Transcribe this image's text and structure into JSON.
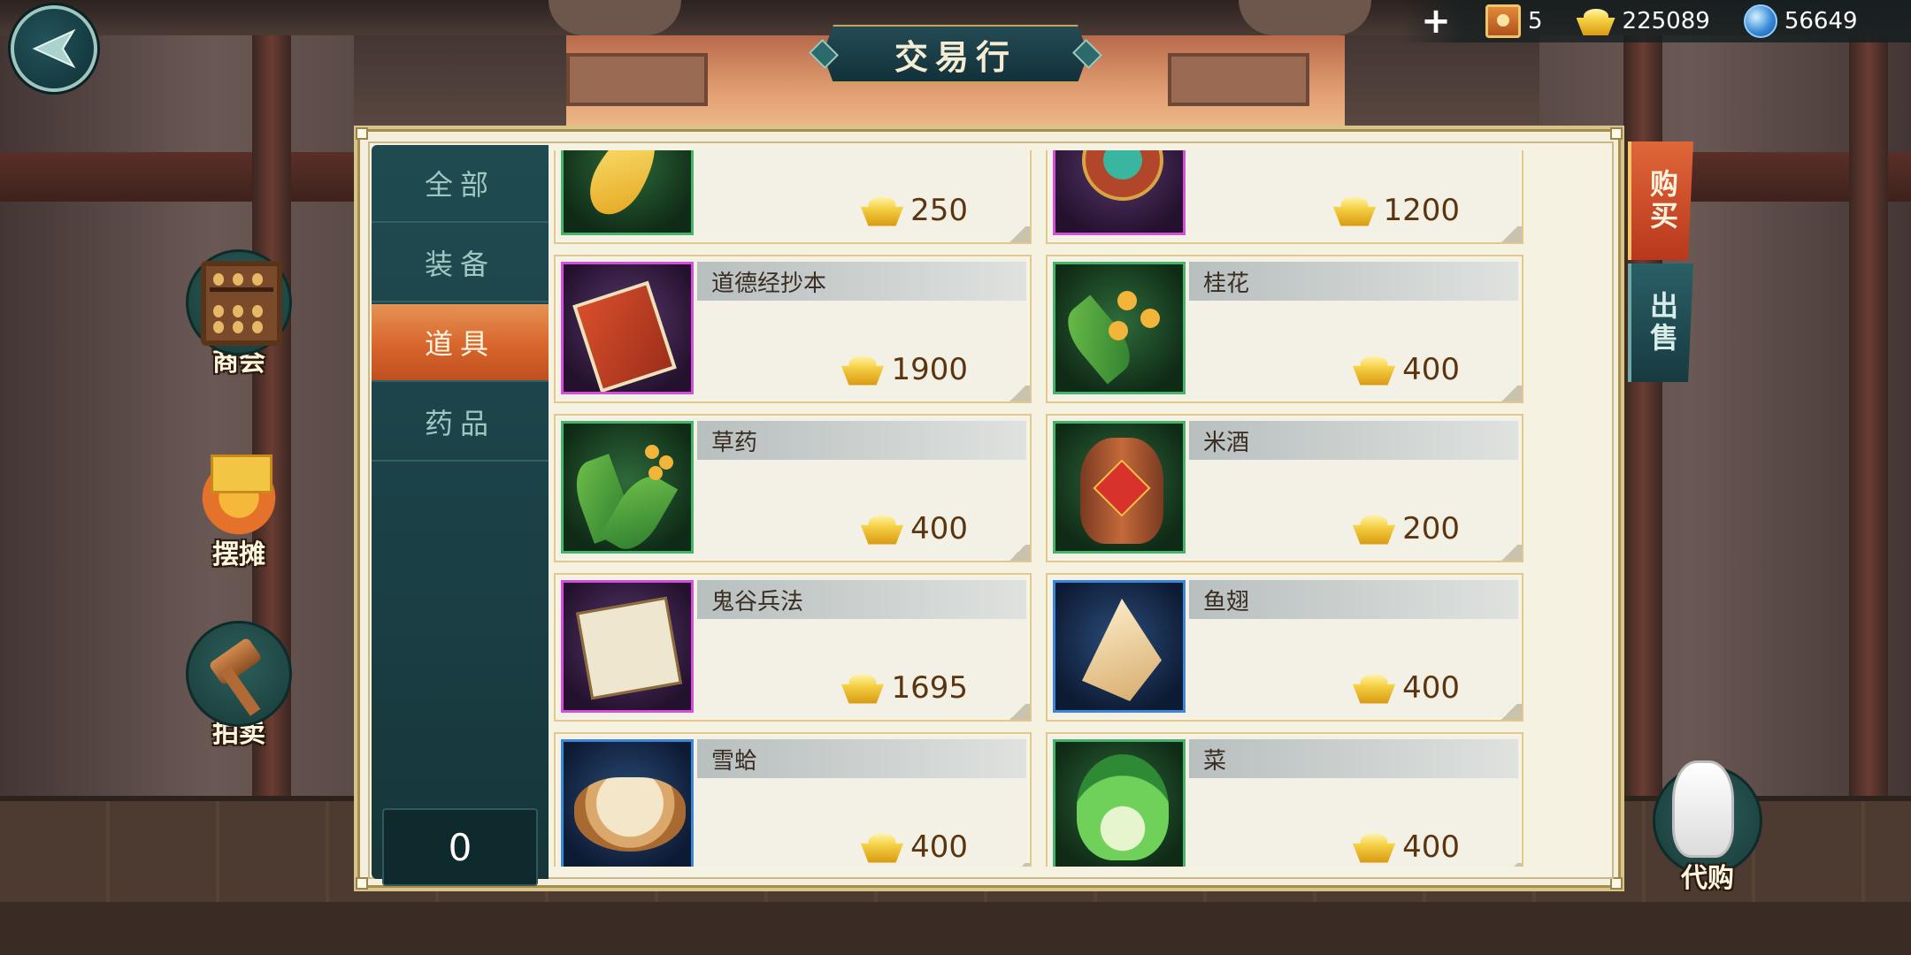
{
  "title": "交易行",
  "currencies": [
    {
      "icon": "ticket-icon",
      "value": "5"
    },
    {
      "icon": "gold-ingot-icon",
      "value": "225089"
    },
    {
      "icon": "blue-pearl-icon",
      "value": "56649"
    }
  ],
  "side_menu": [
    {
      "label": "商会",
      "icon": "abacus-icon"
    },
    {
      "label": "摆摊",
      "icon": "stall-icon"
    },
    {
      "label": "拍卖",
      "icon": "gavel-icon"
    }
  ],
  "categories": [
    "全部",
    "装备",
    "道具",
    "药品"
  ],
  "active_category": "道具",
  "counter": "0",
  "items": [
    {
      "name": "",
      "price": "250",
      "icon": "golden-feather-icon",
      "quality": "green"
    },
    {
      "name": "",
      "price": "1200",
      "icon": "embroidered-ball-icon",
      "quality": "purple"
    },
    {
      "name": "道德经抄本",
      "price": "1900",
      "icon": "book-icon",
      "quality": "purple"
    },
    {
      "name": "桂花",
      "price": "400",
      "icon": "osmanthus-icon",
      "quality": "green"
    },
    {
      "name": "草药",
      "price": "400",
      "icon": "herb-icon",
      "quality": "green"
    },
    {
      "name": "米酒",
      "price": "200",
      "icon": "wine-jar-icon",
      "quality": "green"
    },
    {
      "name": "鬼谷兵法",
      "price": "1695",
      "icon": "scroll-icon",
      "quality": "purple"
    },
    {
      "name": "鱼翅",
      "price": "400",
      "icon": "shark-fin-icon",
      "quality": "blue"
    },
    {
      "name": "雪蛤",
      "price": "400",
      "icon": "soup-bowl-icon",
      "quality": "blue"
    },
    {
      "name": "菜",
      "price": "400",
      "icon": "cabbage-icon",
      "quality": "green"
    }
  ],
  "tabs": {
    "buy": "购买",
    "sell": "出售"
  },
  "proxy_label": "代购"
}
